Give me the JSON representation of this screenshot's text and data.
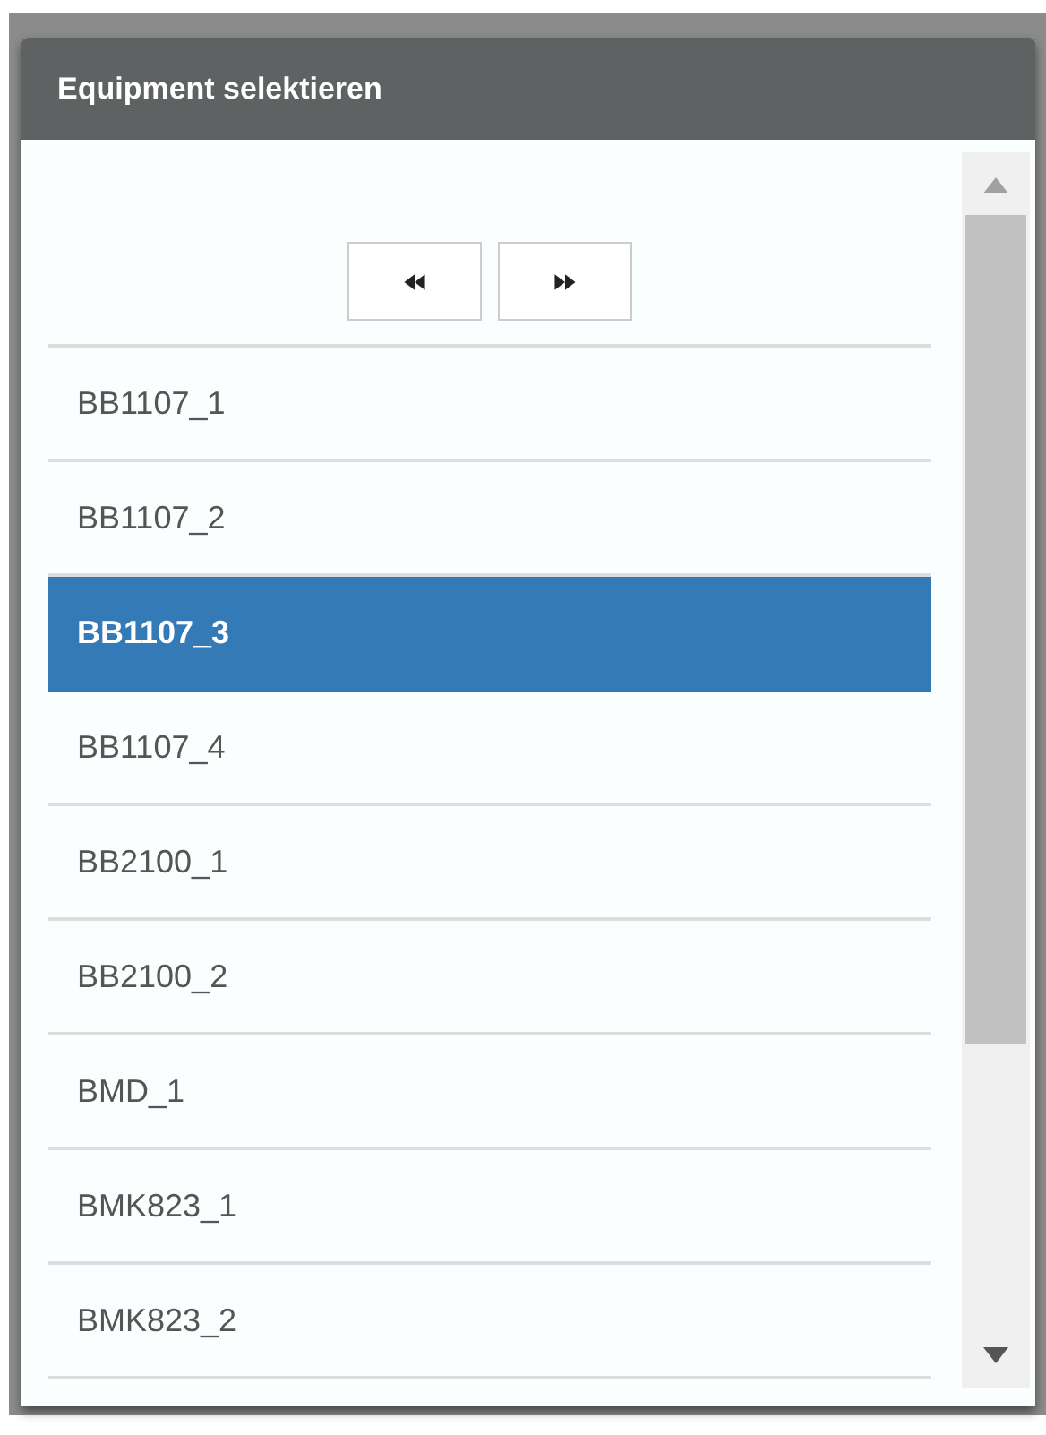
{
  "window": {
    "title": "Equipment selektieren"
  },
  "items": [
    {
      "label": "BB1107_1",
      "selected": false
    },
    {
      "label": "BB1107_2",
      "selected": false
    },
    {
      "label": "BB1107_3",
      "selected": true
    },
    {
      "label": "BB1107_4",
      "selected": false
    },
    {
      "label": "BB2100_1",
      "selected": false
    },
    {
      "label": "BB2100_2",
      "selected": false
    },
    {
      "label": "BMD_1",
      "selected": false
    },
    {
      "label": "BMK823_1",
      "selected": false
    },
    {
      "label": "BMK823_2",
      "selected": false
    }
  ]
}
